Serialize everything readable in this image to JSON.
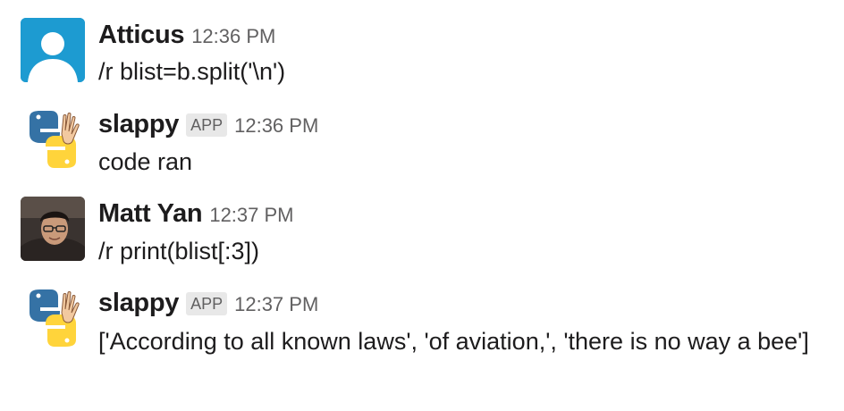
{
  "messages": [
    {
      "author": "Atticus",
      "badge": "",
      "time": "12:36 PM",
      "text": "/r blist=b.split('\\n')",
      "avatar_icon": "default-user-avatar-icon"
    },
    {
      "author": "slappy",
      "badge": "APP",
      "time": "12:36 PM",
      "text": "code ran",
      "avatar_icon": "python-waving-hand-icon"
    },
    {
      "author": "Matt Yan",
      "badge": "",
      "time": "12:37 PM",
      "text": "/r print(blist[:3])",
      "avatar_icon": "user-photo-avatar"
    },
    {
      "author": "slappy",
      "badge": "APP",
      "time": "12:37 PM",
      "text": "['According to all known laws', 'of aviation,', 'there is no way a bee']",
      "avatar_icon": "python-waving-hand-icon"
    }
  ],
  "colors": {
    "text": "#1d1c1d",
    "muted": "#616061",
    "badge_bg": "#e8e8e8",
    "default_avatar_bg": "#1d9bd1",
    "python_blue": "#3572a5",
    "python_yellow": "#ffd43b"
  }
}
